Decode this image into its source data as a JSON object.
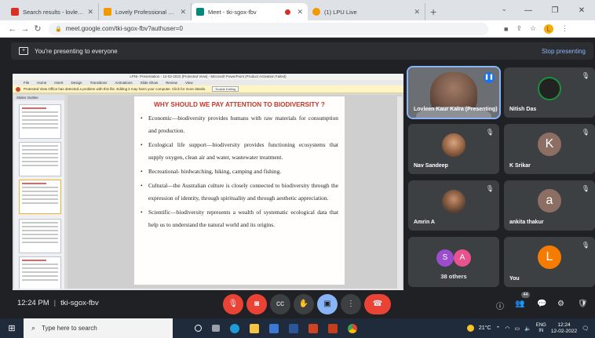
{
  "browser": {
    "tabs": [
      {
        "title": "Search results - lovleen.18863@...",
        "favicon_color": "#d93025",
        "active": false
      },
      {
        "title": "Lovely Professional University - L...",
        "favicon_color": "#f29900",
        "active": false
      },
      {
        "title": "Meet - tki-sgox-fbv",
        "favicon_color": "#00897b",
        "active": true
      },
      {
        "title": "(1) LPU Live",
        "favicon_color": "#f29900",
        "active": false
      }
    ],
    "new_tab": "+",
    "url": "meet.google.com/tki-sgox-fbv?authuser=0"
  },
  "meet": {
    "presenting_banner": "You're presenting to everyone",
    "stop_presenting": "Stop presenting",
    "meeting_time": "12:24 PM",
    "meeting_code": "tki-sgox-fbv",
    "people_count": "44",
    "participants": [
      {
        "name": "Lovleen Kaur Kalra (Presenting)",
        "type": "video"
      },
      {
        "name": "Nitish Das",
        "type": "photo",
        "muted": true
      },
      {
        "name": "Nav Sandeep",
        "type": "photo",
        "muted": true
      },
      {
        "name": "K Srikar",
        "type": "initial",
        "initial": "K",
        "color": "#8d6e63",
        "muted": true
      },
      {
        "name": "Amrin A",
        "type": "photo",
        "muted": true
      },
      {
        "name": "ankita thakur",
        "type": "initial",
        "initial": "a",
        "color": "#8d6e63",
        "muted": true
      },
      {
        "name": "You",
        "type": "initial",
        "initial": "L",
        "color": "#f57c00",
        "muted": true
      }
    ],
    "others": {
      "label": "38 others",
      "avatars": [
        {
          "initial": "S",
          "color": "#9c4dcc"
        },
        {
          "initial": "A",
          "color": "#e8538f"
        }
      ]
    }
  },
  "powerpoint": {
    "window_title": "LPNI- Presentation - 12-02-2022 [Protected View] - Microsoft PowerPoint (Product Activation Failed)",
    "ribbon": [
      "File",
      "Home",
      "Insert",
      "Design",
      "Transitions",
      "Animations",
      "Slide Show",
      "Review",
      "View"
    ],
    "protected_view": "Protected View   Office has detected a problem with this file. Editing it may harm your computer. Click for more details.",
    "protected_button": "Enable Editing",
    "panel_tabs": "Slides   Outline",
    "status": [
      "Slide 5 of 15",
      "\"Office Theme\"",
      "English (U.S.)"
    ],
    "zoom": "37%",
    "slide": {
      "title": "WHY SHOULD WE PAY ATTENTION TO BIODIVERSITY ?",
      "bullets": [
        "Economic—biodiversity provides humans with raw materials for consumption and production.",
        "Ecological life support—biodiversity provides functioning ecosystems that supply oxygen, clean air and water, wastewater treatment.",
        "Recreational- birdwatching, hiking, camping and fishing.",
        "Cultural—the Australian culture is closely connected to biodiversity through the expression of identity, through spirituality and through aesthetic appreciation.",
        "Scientific—biodiversity represents a wealth of systematic ecological data that help us to understand the natural world and its origins."
      ]
    }
  },
  "taskbar": {
    "search_placeholder": "Type here to search",
    "weather": "21°C",
    "lang_top": "ENG",
    "lang_bottom": "IN",
    "time": "12:24",
    "date": "12-02-2022"
  },
  "colors": {
    "meet_bg": "#202124",
    "tile_bg": "#3c4043",
    "end_call": "#ea4335",
    "accent": "#8ab4f8",
    "slide_title": "#c0392b"
  }
}
